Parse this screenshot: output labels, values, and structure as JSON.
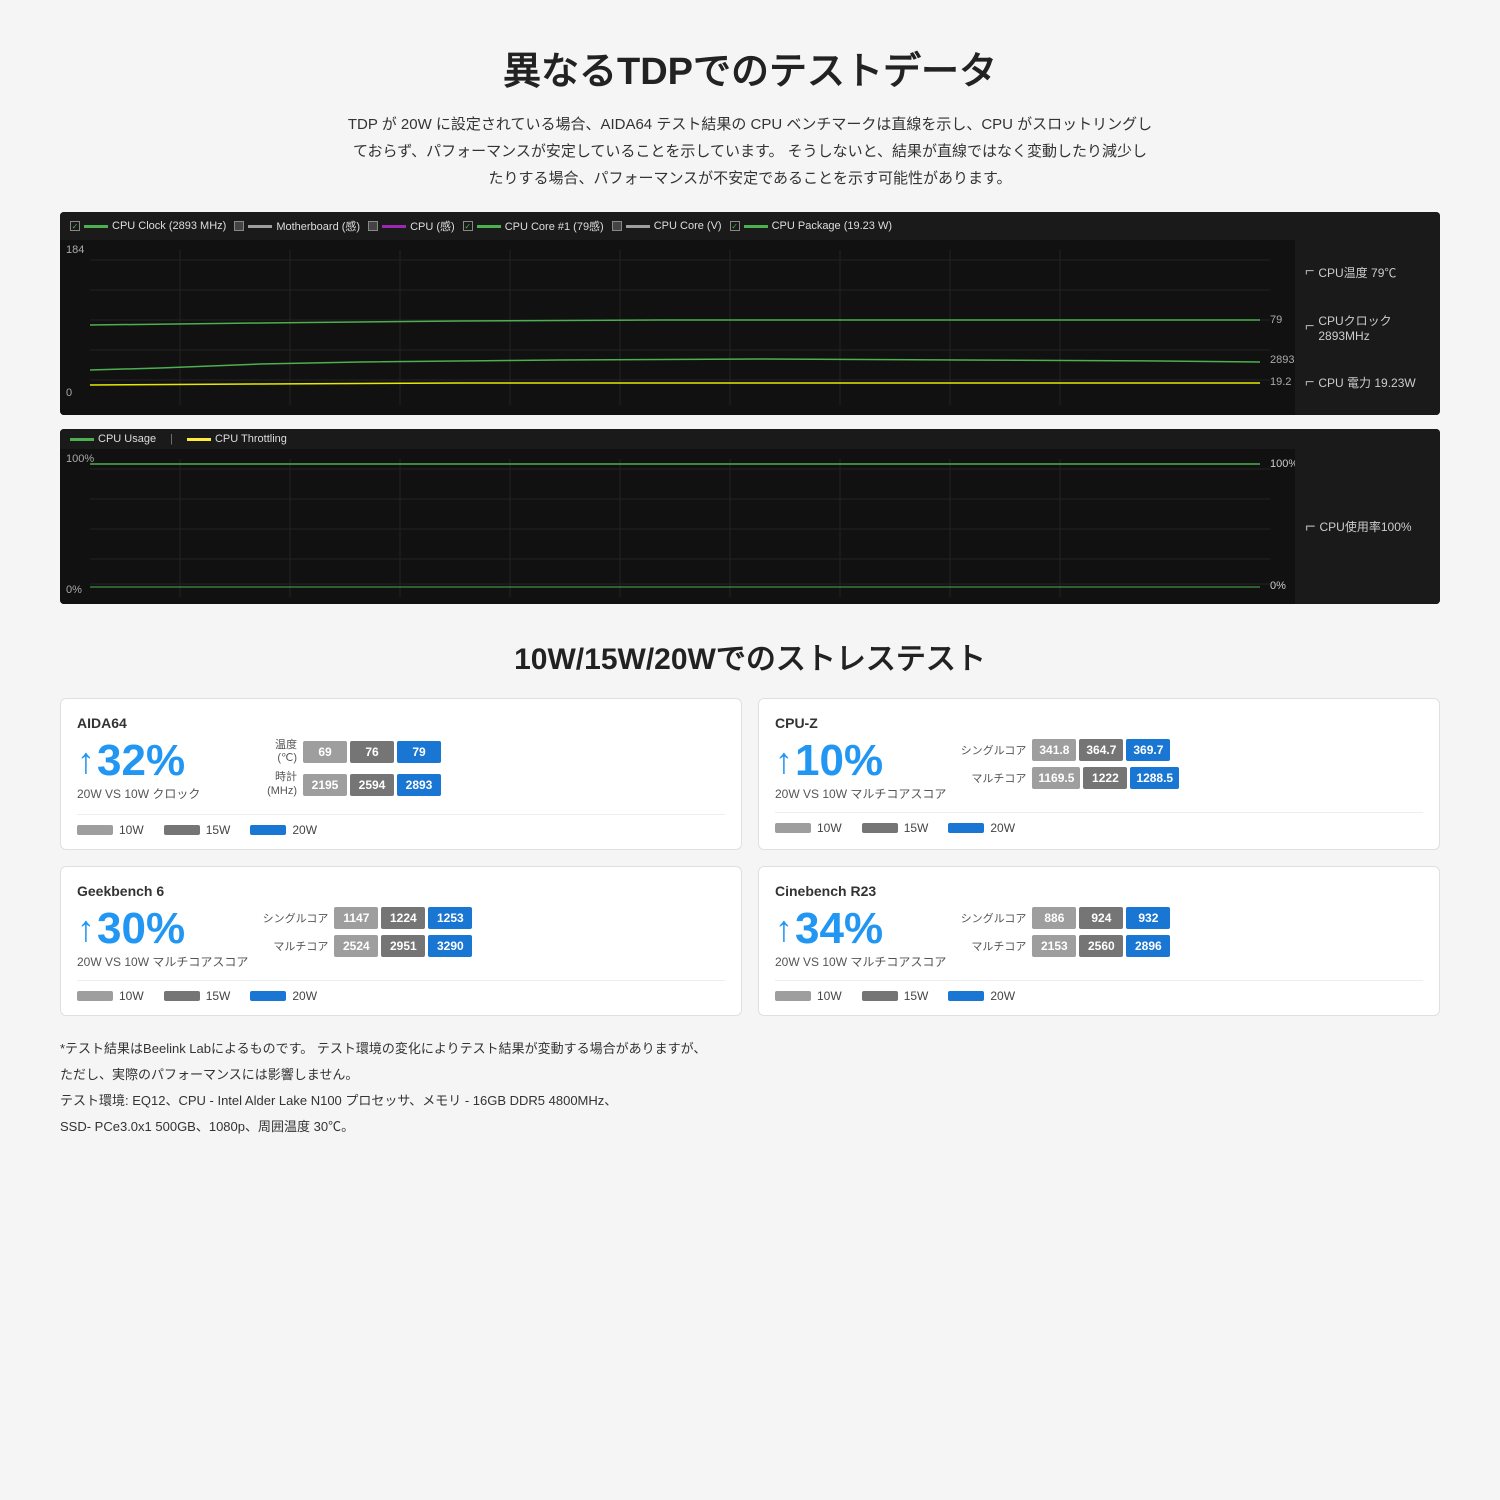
{
  "page": {
    "main_title": "異なるTDPでのテストデータ",
    "description_lines": [
      "TDP が 20W に設定されている場合、AIDA64 テスト結果の CPU ベンチマークは直線を示し、CPU がスロットリングし",
      "ておらず、パフォーマンスが安定していることを示しています。 そうしないと、結果が直線ではなく変動したり減少し",
      "たりする場合、パフォーマンスが不安定であることを示す可能性があります。"
    ],
    "chart_legend": [
      {
        "id": "cpu_clock",
        "label": "CPU Clock (2893 MHz)",
        "color": "#4caf50",
        "checked": true
      },
      {
        "id": "motherboard",
        "label": "Motherboard (感)",
        "color": "#9e9e9e",
        "checked": false
      },
      {
        "id": "cpu",
        "label": "CPU (感)",
        "color": "#9c27b0",
        "checked": false
      },
      {
        "id": "cpu_core1",
        "label": "CPU Core #1 (79感)",
        "color": "#4caf50",
        "checked": true
      },
      {
        "id": "cpu_core_v",
        "label": "CPU Core (V)",
        "color": "#9e9e9e",
        "checked": false
      },
      {
        "id": "cpu_package",
        "label": "CPU Package (19.23 W)",
        "color": "#4caf50",
        "checked": true
      }
    ],
    "chart_top_right_labels": [
      {
        "id": "cpu_temp",
        "label": "CPU温度 79℃",
        "color": "#4caf50"
      },
      {
        "id": "cpu_clock",
        "label": "CPUクロック 2893MHz",
        "color": "#4caf50"
      },
      {
        "id": "cpu_power",
        "label": "CPU 電力 19.23W",
        "color": "#4caf50"
      }
    ],
    "chart_top_y": {
      "top": "184",
      "bottom": "0"
    },
    "chart_top_values": {
      "v1": "79",
      "v2": "2893",
      "v3": "19.2"
    },
    "chart_bottom_legend": [
      {
        "id": "usage",
        "label": "CPU Usage",
        "color": "#4caf50"
      },
      {
        "id": "throttle",
        "label": "CPU Throttling",
        "color": "#ffeb3b"
      }
    ],
    "chart_bottom_y": {
      "top": "100%",
      "bottom": "0%"
    },
    "chart_bottom_values": {
      "top": "100%",
      "bottom": "0%"
    },
    "chart_bottom_right_label": "CPU使用率100%",
    "section2_title": "10W/15W/20Wでのストレステスト",
    "cards": [
      {
        "id": "aida64",
        "title": "AIDA64",
        "percentage": "32%",
        "sub_label": "20W VS 10W クロック",
        "rows": [
          {
            "label": "温度\n(℃)",
            "values": [
              {
                "val": "69",
                "style": "gray"
              },
              {
                "val": "76",
                "style": "darkgray"
              },
              {
                "val": "79",
                "style": "blue"
              }
            ]
          },
          {
            "label": "時計\n(MHz)",
            "values": [
              {
                "val": "2195",
                "style": "gray"
              },
              {
                "val": "2594",
                "style": "darkgray"
              },
              {
                "val": "2893",
                "style": "blue"
              }
            ]
          }
        ],
        "legend": [
          {
            "label": "10W",
            "style": "gray"
          },
          {
            "label": "15W",
            "style": "darkgray"
          },
          {
            "label": "20W",
            "style": "blue"
          }
        ]
      },
      {
        "id": "cpuz",
        "title": "CPU-Z",
        "percentage": "10%",
        "sub_label": "20W VS 10W マルチコアスコア",
        "rows": [
          {
            "label": "シングルコア",
            "values": [
              {
                "val": "341.8",
                "style": "gray"
              },
              {
                "val": "364.7",
                "style": "darkgray"
              },
              {
                "val": "369.7",
                "style": "blue"
              }
            ]
          },
          {
            "label": "マルチコア",
            "values": [
              {
                "val": "1169.5",
                "style": "gray"
              },
              {
                "val": "1222",
                "style": "darkgray"
              },
              {
                "val": "1288.5",
                "style": "blue"
              }
            ]
          }
        ],
        "legend": [
          {
            "label": "10W",
            "style": "gray"
          },
          {
            "label": "15W",
            "style": "darkgray"
          },
          {
            "label": "20W",
            "style": "blue"
          }
        ]
      },
      {
        "id": "geekbench6",
        "title": "Geekbench 6",
        "percentage": "30%",
        "sub_label": "20W VS 10W マルチコアスコア",
        "rows": [
          {
            "label": "シングルコア",
            "values": [
              {
                "val": "1147",
                "style": "gray"
              },
              {
                "val": "1224",
                "style": "darkgray"
              },
              {
                "val": "1253",
                "style": "blue"
              }
            ]
          },
          {
            "label": "マルチコア",
            "values": [
              {
                "val": "2524",
                "style": "gray"
              },
              {
                "val": "2951",
                "style": "darkgray"
              },
              {
                "val": "3290",
                "style": "blue"
              }
            ]
          }
        ],
        "legend": [
          {
            "label": "10W",
            "style": "gray"
          },
          {
            "label": "15W",
            "style": "darkgray"
          },
          {
            "label": "20W",
            "style": "blue"
          }
        ]
      },
      {
        "id": "cinebench",
        "title": "Cinebench R23",
        "percentage": "34%",
        "sub_label": "20W VS 10W マルチコアスコア",
        "rows": [
          {
            "label": "シングルコア",
            "values": [
              {
                "val": "886",
                "style": "gray"
              },
              {
                "val": "924",
                "style": "darkgray"
              },
              {
                "val": "932",
                "style": "blue"
              }
            ]
          },
          {
            "label": "マルチコア",
            "values": [
              {
                "val": "2153",
                "style": "gray"
              },
              {
                "val": "2560",
                "style": "darkgray"
              },
              {
                "val": "2896",
                "style": "blue"
              }
            ]
          }
        ],
        "legend": [
          {
            "label": "10W",
            "style": "gray"
          },
          {
            "label": "15W",
            "style": "darkgray"
          },
          {
            "label": "20W",
            "style": "blue"
          }
        ]
      }
    ],
    "footer_notes": [
      "*テスト結果はBeelink Labによるものです。 テスト環境の変化によりテスト結果が変動する場合がありますが、",
      "ただし、実際のパフォーマンスには影響しません。",
      "テスト環境: EQ12、CPU - Intel Alder Lake N100 プロセッサ、メモリ - 16GB DDR5 4800MHz、",
      "SSD- PCe3.0x1 500GB、1080p、周囲温度 30℃。"
    ]
  }
}
